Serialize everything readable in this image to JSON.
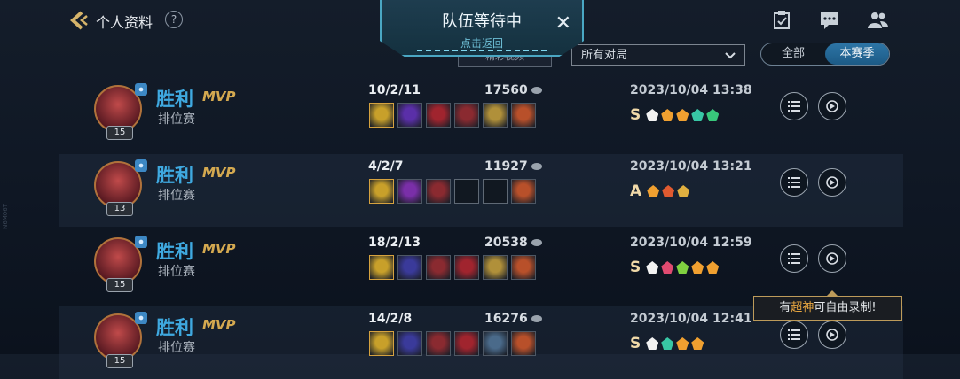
{
  "header": {
    "title": "个人资料",
    "help": "?"
  },
  "queue": {
    "title": "队伍等待中",
    "subtitle": "点击返回",
    "close": "✕",
    "partial_button": "精彩视频"
  },
  "filter": {
    "select_value": "所有对局",
    "seg_all": "全部",
    "seg_season": "本赛季"
  },
  "side_text": "N6M06T",
  "matches": [
    {
      "result": "胜利",
      "mvp": "MVP",
      "mode": "排位赛",
      "level": "15",
      "kda": "10/2/11",
      "score": "17560",
      "date": "2023/10/04 13:38",
      "grade": "S",
      "items": [
        "#c8a02a",
        "#5a2fa8",
        "#a0242e",
        "#8a2a30",
        "#b0903a",
        "#b8502a"
      ],
      "badges": [
        "#f2f2f2",
        "#f0a030",
        "#f0a030",
        "#38c7a5",
        "#38c77a"
      ]
    },
    {
      "result": "胜利",
      "mvp": "MVP",
      "mode": "排位赛",
      "level": "13",
      "kda": "4/2/7",
      "score": "11927",
      "date": "2023/10/04 13:21",
      "grade": "A",
      "items": [
        "#c8a02a",
        "#7a2fa8",
        "#8a2a30",
        "empty",
        "empty",
        "#b8502a"
      ],
      "badges": [
        "#f0a030",
        "#e05a30",
        "#e0b040"
      ]
    },
    {
      "result": "胜利",
      "mvp": "MVP",
      "mode": "排位赛",
      "level": "15",
      "kda": "18/2/13",
      "score": "20538",
      "date": "2023/10/04 12:59",
      "grade": "S",
      "items": [
        "#c8a02a",
        "#3a3a9a",
        "#8a2a30",
        "#a0242e",
        "#b0903a",
        "#b8502a"
      ],
      "badges": [
        "#f2f2f2",
        "#e04a70",
        "#80d040",
        "#f0a030",
        "#f0a030"
      ]
    },
    {
      "result": "胜利",
      "mvp": "MVP",
      "mode": "排位赛",
      "level": "15",
      "kda": "14/2/8",
      "score": "16276",
      "date": "2023/10/04 12:41",
      "grade": "S",
      "items": [
        "#c8a02a",
        "#3a3a9a",
        "#8a2a30",
        "#a0242e",
        "#4a6a8a",
        "#b8502a"
      ],
      "badges": [
        "#f2f2f2",
        "#38c7a5",
        "#f0a030",
        "#f0a030"
      ]
    }
  ],
  "tooltip": {
    "prefix": "有",
    "highlight": "超神",
    "suffix": "可自由录制!"
  },
  "colors": {
    "win": "#3fa9e0",
    "mvp": "#d4a950",
    "accent": "#2d75a6"
  }
}
